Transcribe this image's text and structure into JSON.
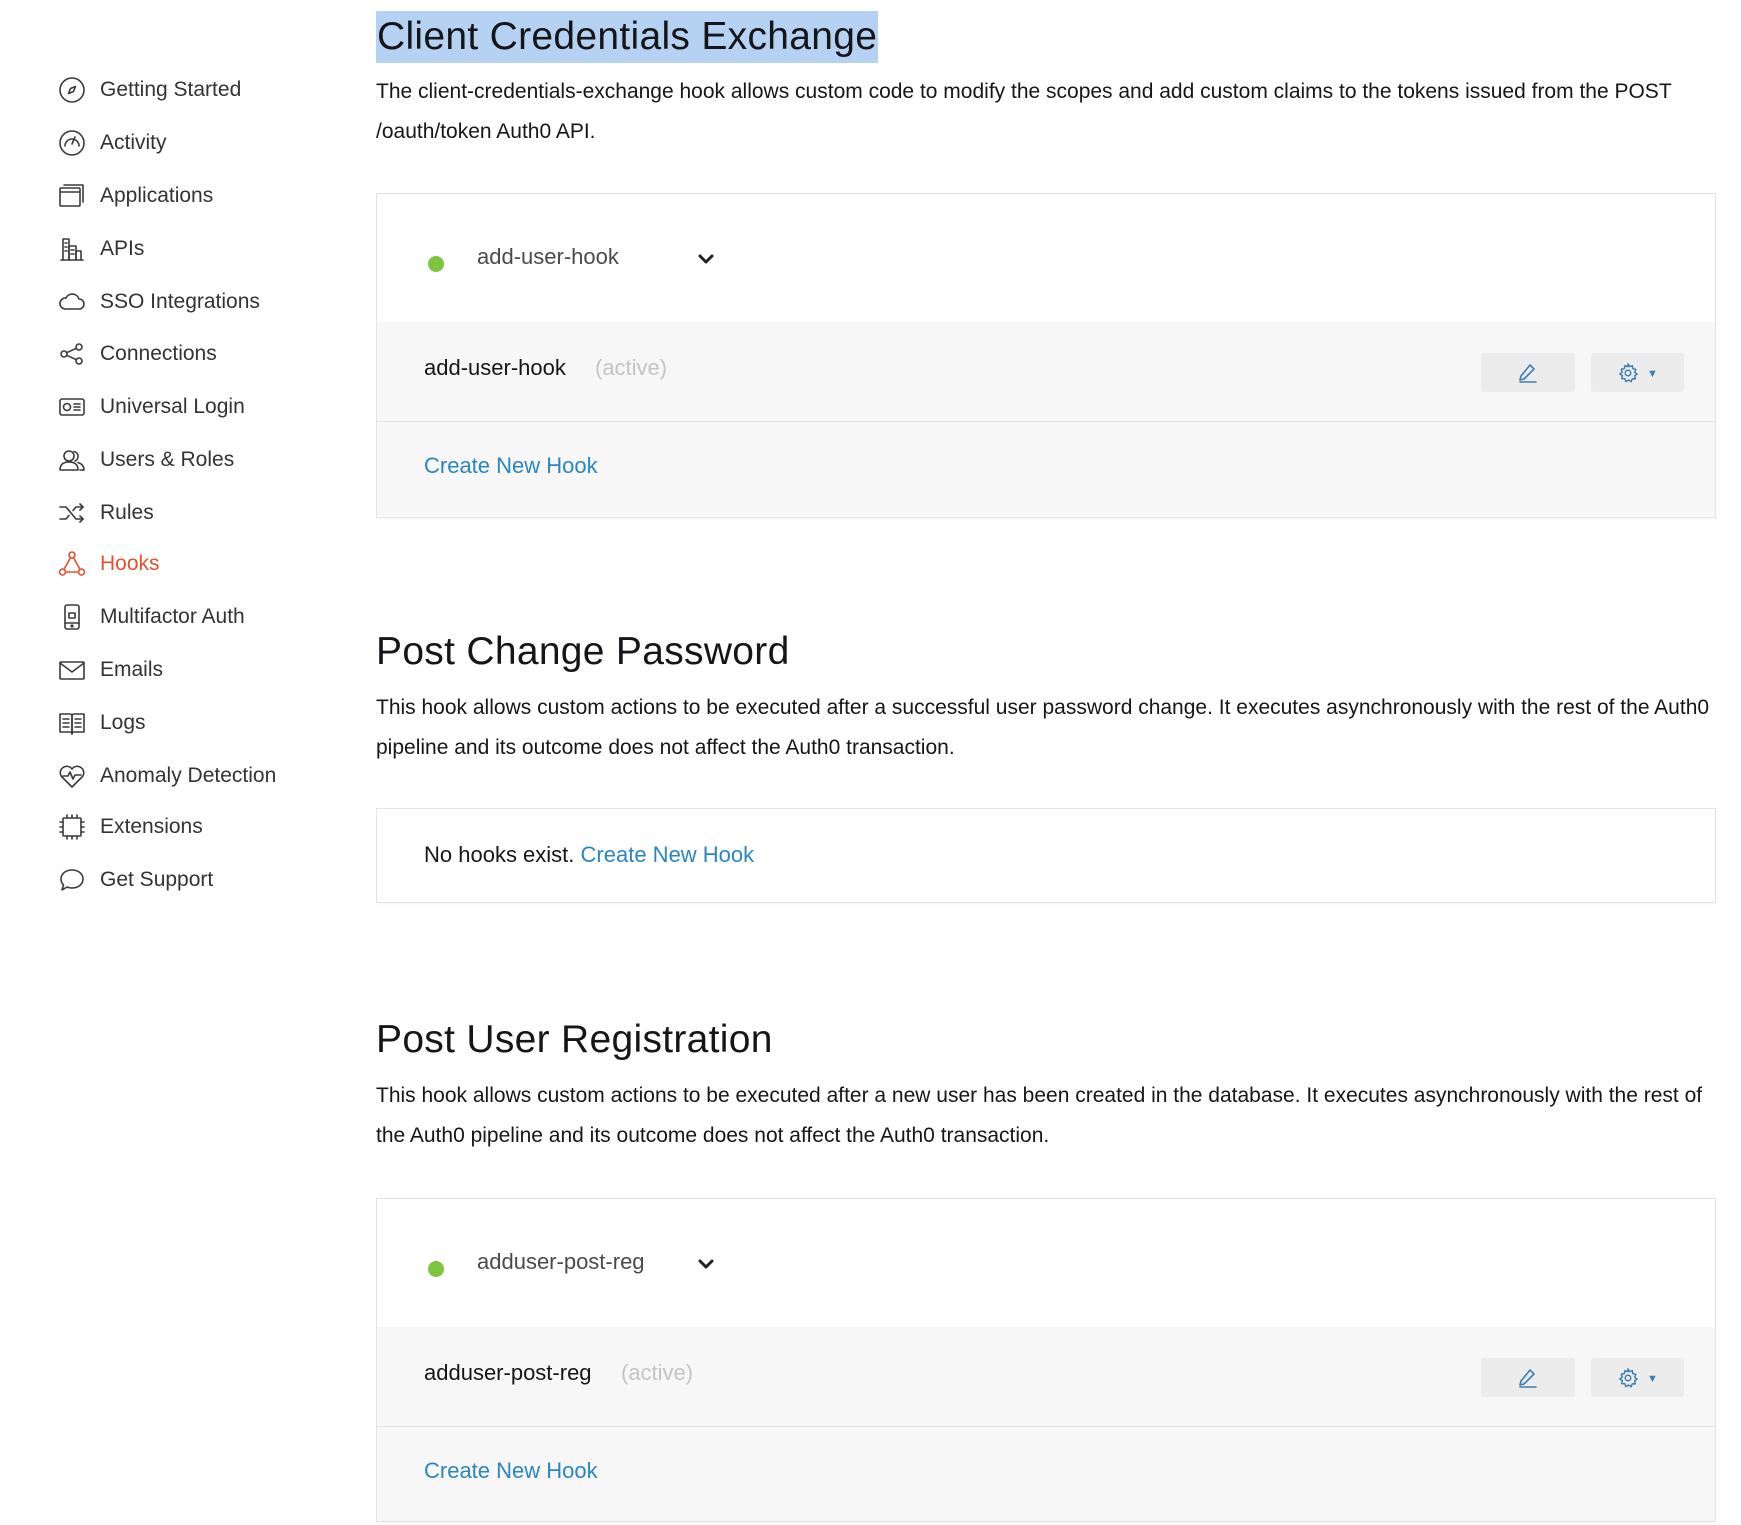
{
  "sidebar": {
    "items": [
      {
        "label": "Getting Started",
        "icon": "compass-icon",
        "active": false
      },
      {
        "label": "Activity",
        "icon": "gauge-icon",
        "active": false
      },
      {
        "label": "Applications",
        "icon": "windows-icon",
        "active": false
      },
      {
        "label": "APIs",
        "icon": "buildings-icon",
        "active": false
      },
      {
        "label": "SSO Integrations",
        "icon": "cloud-icon",
        "active": false
      },
      {
        "label": "Connections",
        "icon": "share-icon",
        "active": false
      },
      {
        "label": "Universal Login",
        "icon": "login-card-icon",
        "active": false
      },
      {
        "label": "Users & Roles",
        "icon": "users-icon",
        "active": false
      },
      {
        "label": "Rules",
        "icon": "shuffle-icon",
        "active": false
      },
      {
        "label": "Hooks",
        "icon": "hooks-icon",
        "active": true
      },
      {
        "label": "Multifactor Auth",
        "icon": "phone-icon",
        "active": false
      },
      {
        "label": "Emails",
        "icon": "envelope-icon",
        "active": false
      },
      {
        "label": "Logs",
        "icon": "book-icon",
        "active": false
      },
      {
        "label": "Anomaly Detection",
        "icon": "heart-pulse-icon",
        "active": false
      },
      {
        "label": "Extensions",
        "icon": "chip-icon",
        "active": false
      },
      {
        "label": "Get Support",
        "icon": "chat-bubble-icon",
        "active": false
      }
    ]
  },
  "sections": {
    "client_credentials": {
      "title": "Client Credentials Exchange",
      "description": "The client-credentials-exchange hook allows custom code to modify the scopes and add custom claims to the tokens issued from the POST /oauth/token Auth0 API.",
      "selected_hook": "add-user-hook",
      "hook_name": "add-user-hook",
      "hook_status": "(active)",
      "create_link": "Create New Hook"
    },
    "post_change_password": {
      "title": "Post Change Password",
      "description": "This hook allows custom actions to be executed after a successful user password change. It executes asynchronously with the rest of the Auth0 pipeline and its outcome does not affect the Auth0 transaction.",
      "empty_text": "No hooks exist.",
      "create_link": "Create New Hook"
    },
    "post_user_registration": {
      "title": "Post User Registration",
      "description": "This hook allows custom actions to be executed after a new user has been created in the database. It executes asynchronously with the rest of the Auth0 pipeline and its outcome does not affect the Auth0 transaction.",
      "selected_hook": "adduser-post-reg",
      "hook_name": "adduser-post-reg",
      "hook_status": "(active)",
      "create_link": "Create New Hook"
    }
  },
  "colors": {
    "accent": "#e2522e",
    "link": "#2b86bd",
    "active_dot": "#7dc43f",
    "highlight": "#b6d2f2"
  }
}
